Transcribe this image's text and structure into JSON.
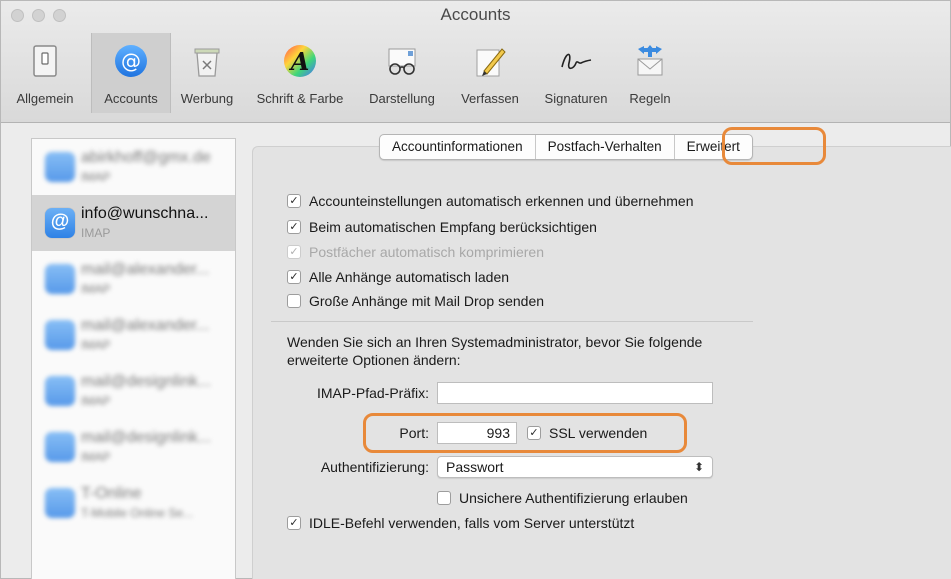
{
  "window": {
    "title": "Accounts"
  },
  "toolbar": {
    "items": [
      {
        "label": "Allgemein",
        "icon": "switch-icon"
      },
      {
        "label": "Accounts",
        "icon": "at-sign-icon"
      },
      {
        "label": "Werbung",
        "icon": "junk-trash-icon"
      },
      {
        "label": "Schrift & Farbe",
        "icon": "font-color-icon"
      },
      {
        "label": "Darstellung",
        "icon": "glasses-icon"
      },
      {
        "label": "Verfassen",
        "icon": "pencil-icon"
      },
      {
        "label": "Signaturen",
        "icon": "signature-icon"
      },
      {
        "label": "Regeln",
        "icon": "rules-envelope-icon"
      }
    ],
    "active": "Accounts"
  },
  "accounts": [
    {
      "name": "abirkhoff@gmx.de",
      "sub": "IMAP",
      "blurred": true
    },
    {
      "name": "info@wunschna...",
      "sub": "IMAP",
      "blurred": false,
      "selected": true
    },
    {
      "name": "mail@alexander...",
      "sub": "IMAP",
      "blurred": true
    },
    {
      "name": "mail@alexander...",
      "sub": "IMAP",
      "blurred": true
    },
    {
      "name": "mail@designlink...",
      "sub": "IMAP",
      "blurred": true
    },
    {
      "name": "mail@designlink...",
      "sub": "IMAP",
      "blurred": true
    },
    {
      "name": "T-Online",
      "sub": "T-Mobile Online Se...",
      "blurred": true
    }
  ],
  "tabs": [
    "Accountinformationen",
    "Postfach-Verhalten",
    "Erweitert"
  ],
  "active_tab": "Erweitert",
  "options": [
    {
      "label": "Accounteinstellungen automatisch erkennen und übernehmen",
      "checked": true,
      "disabled": false
    },
    {
      "label": "Beim automatischen Empfang berücksichtigen",
      "checked": true,
      "disabled": false
    },
    {
      "label": "Postfächer automatisch komprimieren",
      "checked": true,
      "disabled": true
    },
    {
      "label": "Alle Anhänge automatisch laden",
      "checked": true,
      "disabled": false
    },
    {
      "label": "Große Anhänge mit Mail Drop senden",
      "checked": false,
      "disabled": false
    }
  ],
  "advanced_note": "Wenden Sie sich an Ihren Systemadministrator, bevor Sie folgende erweiterte Optionen ändern:",
  "imap_prefix": {
    "label": "IMAP-Pfad-Präfix:",
    "value": ""
  },
  "port": {
    "label": "Port:",
    "value": "993"
  },
  "ssl": {
    "label": "SSL verwenden",
    "checked": true
  },
  "auth": {
    "label": "Authentifizierung:",
    "value": "Passwort"
  },
  "insecure_auth": {
    "label": "Unsichere Authentifizierung erlauben",
    "checked": false
  },
  "idle": {
    "label": "IDLE-Befehl verwenden, falls vom Server unterstützt",
    "checked": true
  },
  "check_glyph": "✓",
  "colors": {
    "highlight": "#e8893a",
    "accent": "#2f82e6"
  }
}
